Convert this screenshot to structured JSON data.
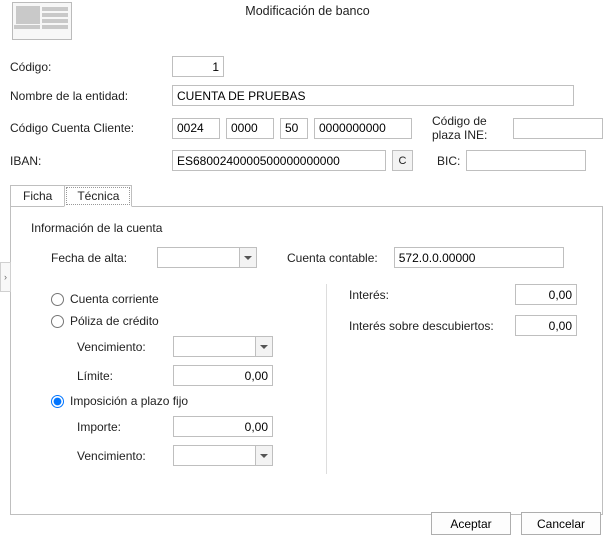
{
  "title": "Modificación de banco",
  "labels": {
    "codigo": "Código:",
    "nombre_entidad": "Nombre de la entidad:",
    "ccc": "Código Cuenta Cliente:",
    "ine": "Código de plaza INE:",
    "iban": "IBAN:",
    "bic": "BIC:"
  },
  "values": {
    "codigo": "1",
    "nombre_entidad": "CUENTA DE PRUEBAS",
    "ccc_bank": "0024",
    "ccc_branch": "0000",
    "ccc_dc": "50",
    "ccc_acc": "0000000000",
    "ine": "",
    "iban": "ES6800240000500000000000",
    "ibanbtn": "C",
    "bic": ""
  },
  "tabs": {
    "ficha": "Ficha",
    "tecnica": "Técnica"
  },
  "tecnica": {
    "section": "Información de la cuenta",
    "fecha_alta": "Fecha de alta:",
    "fecha_alta_v": "",
    "cuenta_contable": "Cuenta contable:",
    "cuenta_contable_v": "572.0.0.00000",
    "r_corriente": "Cuenta corriente",
    "r_poliza": "Póliza de crédito",
    "r_plazo": "Imposición a plazo fijo",
    "vencimiento": "Vencimiento:",
    "vencimiento_v": "",
    "limite": "Límite:",
    "limite_v": "0,00",
    "importe": "Importe:",
    "importe_v": "0,00",
    "venc2_v": "",
    "interes": "Interés:",
    "interes_v": "0,00",
    "interes_d": "Interés sobre descubiertos:",
    "interes_d_v": "0,00"
  },
  "buttons": {
    "ok": "Aceptar",
    "cancel": "Cancelar"
  },
  "collapse": "›"
}
